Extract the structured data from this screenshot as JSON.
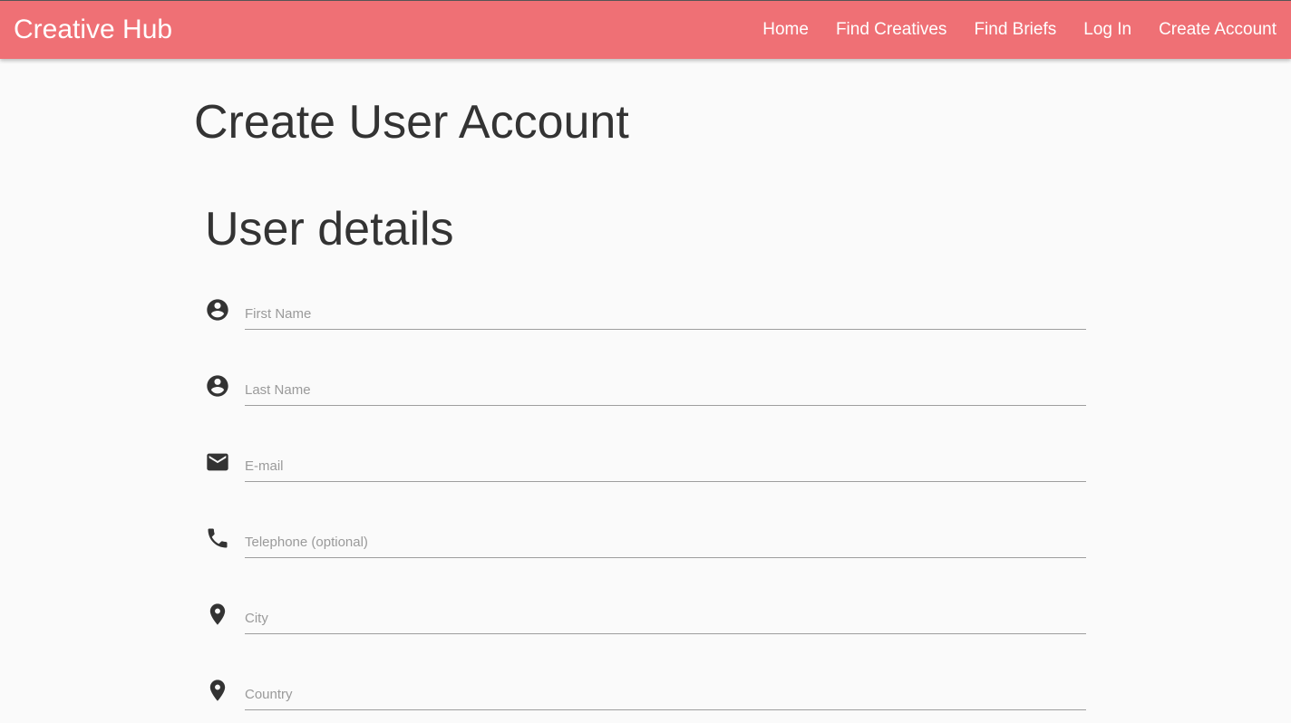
{
  "nav": {
    "brand": "Creative Hub",
    "links": [
      "Home",
      "Find Creatives",
      "Find Briefs",
      "Log In",
      "Create Account"
    ]
  },
  "page": {
    "title": "Create User Account",
    "section_title": "User details"
  },
  "form": {
    "fields": [
      {
        "icon": "account-circle-icon",
        "placeholder": "First Name",
        "value": ""
      },
      {
        "icon": "account-circle-icon",
        "placeholder": "Last Name",
        "value": ""
      },
      {
        "icon": "email-icon",
        "placeholder": "E-mail",
        "value": ""
      },
      {
        "icon": "phone-icon",
        "placeholder": "Telephone (optional)",
        "value": ""
      },
      {
        "icon": "location-pin-icon",
        "placeholder": "City",
        "value": ""
      },
      {
        "icon": "location-pin-icon",
        "placeholder": "Country",
        "value": ""
      }
    ]
  },
  "colors": {
    "navbar": "#ef7075",
    "text": "#333333",
    "background": "#fafafa"
  }
}
